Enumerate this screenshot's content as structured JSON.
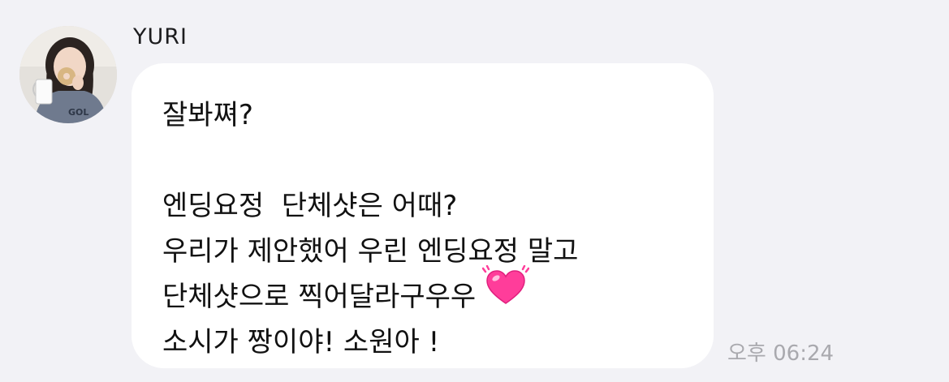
{
  "message": {
    "sender_name": "YURI",
    "lines": [
      "잘봐쪄?",
      "",
      "엔딩요정  단체샷은 어때?",
      "우리가 제안했어 우린 엔딩요정 말고",
      "단체샷으로 찍어달라구우우",
      "소시가 짱이야! 소원아 !"
    ],
    "emoji": "beating-heart-icon",
    "timestamp": "오후 06:24"
  },
  "colors": {
    "background": "#f2f2f6",
    "bubble": "#ffffff",
    "text": "#111111",
    "timestamp": "#a9a9ae",
    "heart": "#ff3d9a"
  }
}
